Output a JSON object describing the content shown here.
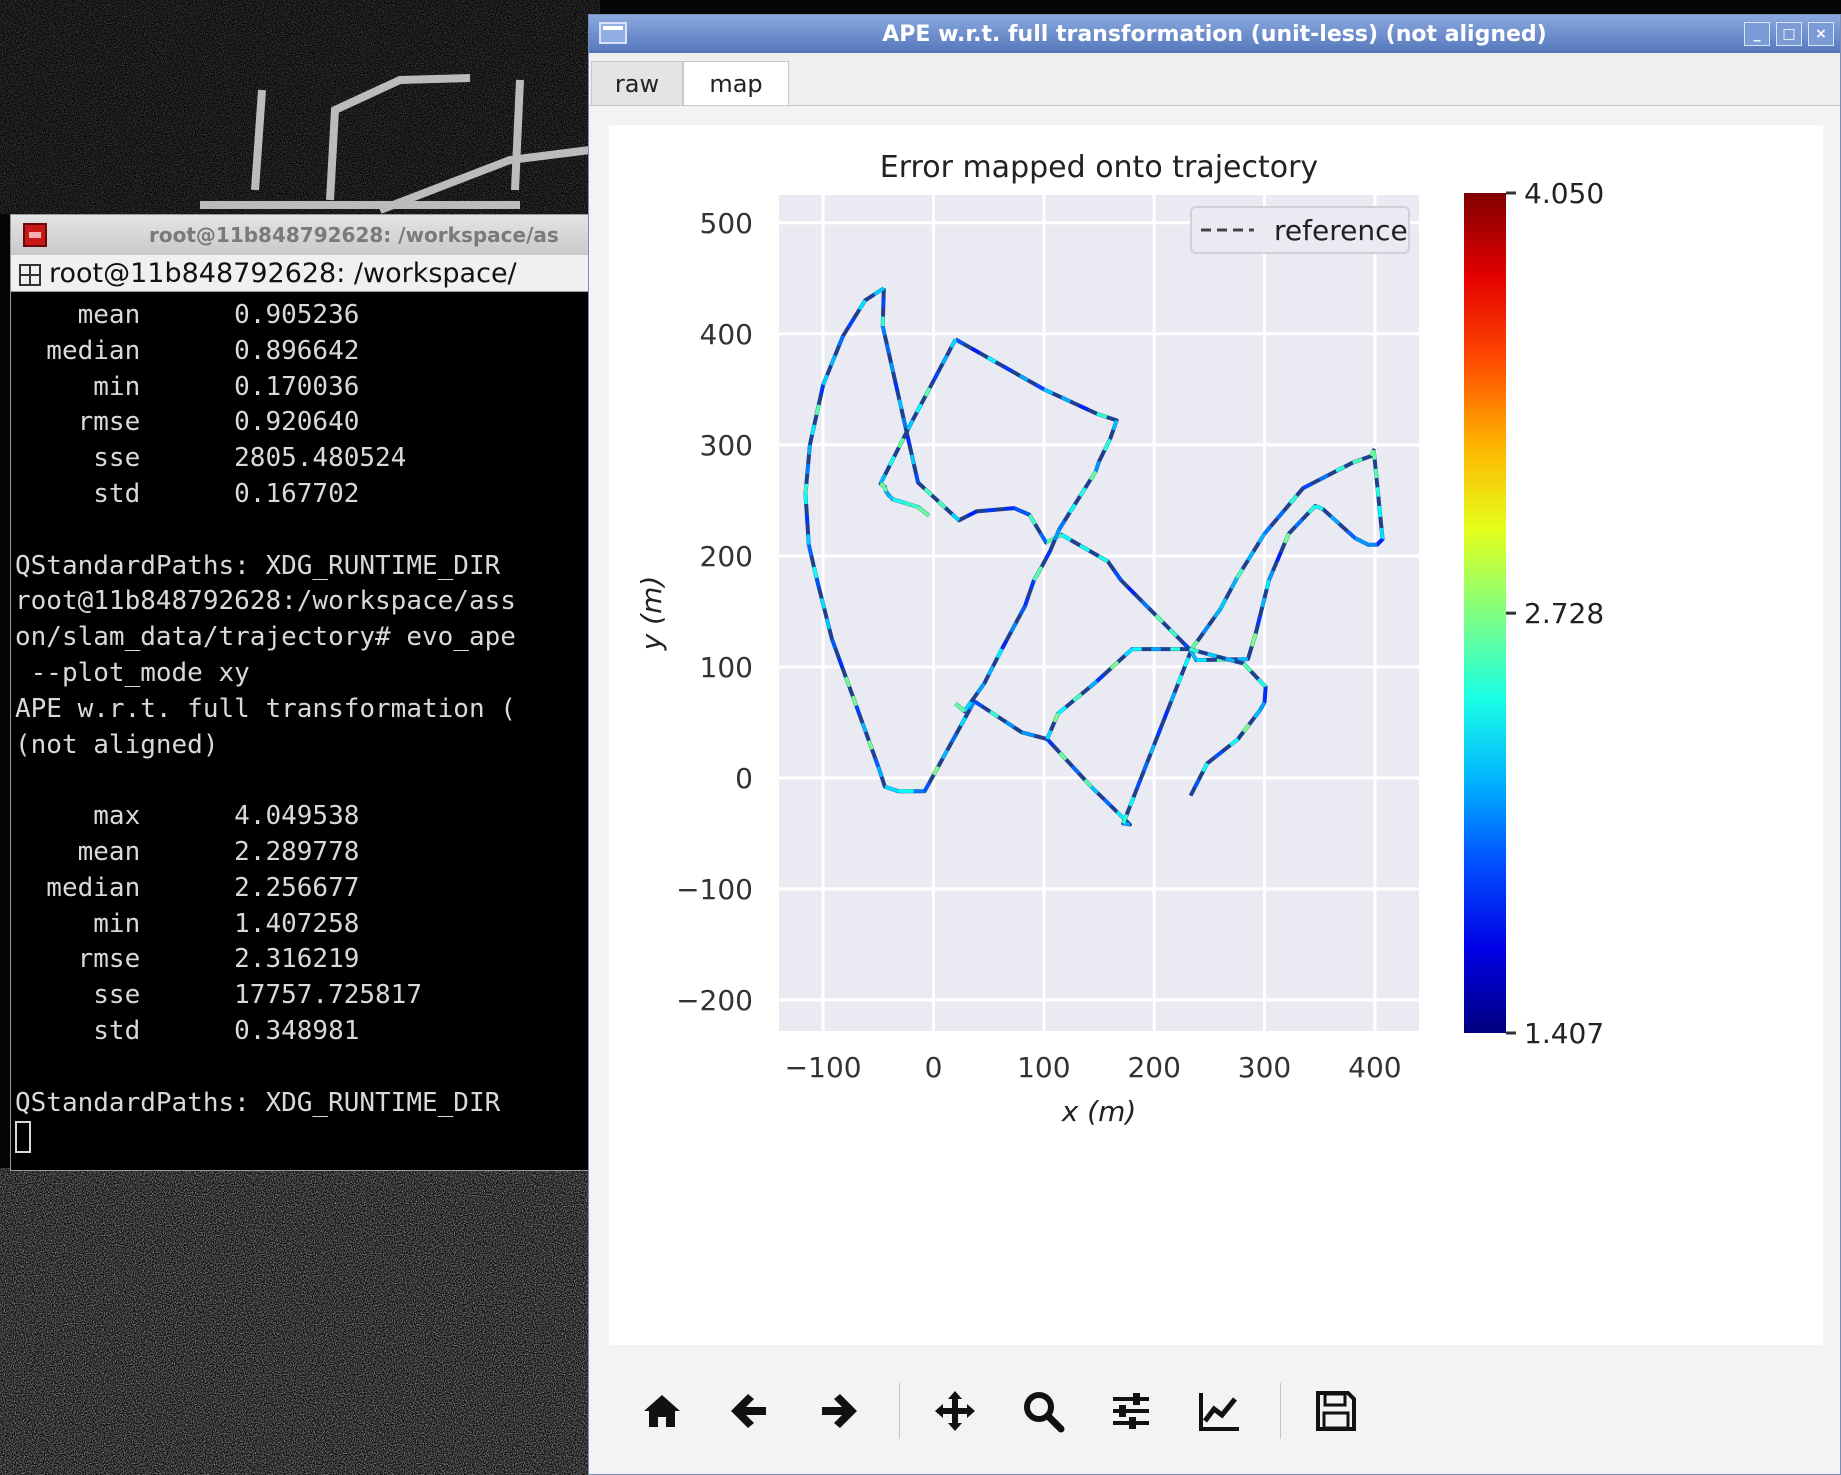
{
  "terminal": {
    "window_title": "root@11b848792628: /workspace/as",
    "tab_label": "root@11b848792628: /workspace/",
    "lines": [
      "    mean      0.905236",
      "  median      0.896642",
      "     min      0.170036",
      "    rmse      0.920640",
      "     sse      2805.480524",
      "     std      0.167702",
      "",
      "QStandardPaths: XDG_RUNTIME_DIR",
      "root@11b848792628:/workspace/ass",
      "on/slam_data/trajectory# evo_ape",
      " --plot_mode xy",
      "APE w.r.t. full transformation (",
      "(not aligned)",
      "",
      "     max      4.049538",
      "    mean      2.289778",
      "  median      2.256677",
      "     min      1.407258",
      "    rmse      2.316219",
      "     sse      17757.725817",
      "     std      0.348981",
      "",
      "QStandardPaths: XDG_RUNTIME_DIR"
    ]
  },
  "plot_window": {
    "title": "APE w.r.t. full transformation (unit-less) (not aligned)",
    "tabs": [
      "raw",
      "map"
    ],
    "active_tab": "map",
    "window_buttons": [
      "_",
      "□",
      "×"
    ],
    "toolbar_icons": [
      "home-icon",
      "back-arrow-icon",
      "forward-arrow-icon",
      "pan-move-icon",
      "zoom-magnifier-icon",
      "configure-subplots-icon",
      "edit-axis-icon",
      "save-icon"
    ]
  },
  "chart_data": {
    "type": "line",
    "title": "Error mapped onto trajectory",
    "xlabel": "x (m)",
    "ylabel": "y (m)",
    "xlim": [
      -140,
      440
    ],
    "ylim": [
      -228,
      525
    ],
    "xticks": [
      -100,
      0,
      100,
      200,
      300,
      400
    ],
    "xtick_labels": [
      "−100",
      "0",
      "100",
      "200",
      "300",
      "400"
    ],
    "yticks": [
      -200,
      -100,
      0,
      100,
      200,
      300,
      400,
      500
    ],
    "ytick_labels": [
      "−200",
      "−100",
      "0",
      "100",
      "200",
      "300",
      "400",
      "500"
    ],
    "grid": true,
    "background": "#eaeaf2",
    "legend": {
      "placement": "top-right",
      "entries": [
        "reference"
      ]
    },
    "colorbar": {
      "min": 1.407,
      "max": 4.05,
      "tick_values": [
        4.05,
        2.728,
        1.407
      ],
      "tick_labels": [
        "4.050",
        "2.728",
        "1.407"
      ],
      "colormap": "jet"
    },
    "series": [
      {
        "name": "reference",
        "style": "dashed",
        "color_by_error": true,
        "x": [
          -45,
          -62,
          -82,
          -100,
          -112,
          -116,
          -113,
          -106,
          -92,
          -70,
          -50,
          -44,
          -32,
          -18,
          -8,
          37,
          80,
          103,
          143,
          178,
          172,
          234,
          260,
          275,
          300,
          335,
          380,
          397,
          399,
          404,
          407,
          402,
          394,
          382,
          353,
          346,
          322,
          304,
          292,
          285,
          238,
          233,
          170,
          158,
          116,
          102,
          87,
          73,
          39,
          23,
          -14,
          -46,
          -45
        ],
        "y": [
          441,
          430,
          398,
          354,
          300,
          256,
          210,
          180,
          125,
          65,
          10,
          -8,
          -12,
          -12,
          -12,
          69,
          41,
          35,
          -8,
          -42,
          -41,
          116,
          152,
          180,
          220,
          261,
          284,
          290,
          295,
          245,
          215,
          210,
          210,
          216,
          242,
          245,
          220,
          178,
          130,
          107,
          106,
          115,
          178,
          195,
          219,
          212,
          237,
          243,
          240,
          232,
          266,
          407,
          441
        ]
      },
      {
        "name": "",
        "style": "dashed",
        "color_by_error": true,
        "x": [
          20,
          100,
          148,
          166,
          160,
          150,
          147,
          114,
          106,
          98,
          91,
          83,
          62,
          46,
          28,
          20
        ],
        "y": [
          395,
          350,
          328,
          322,
          305,
          285,
          276,
          224,
          205,
          190,
          178,
          155,
          116,
          85,
          60,
          67
        ]
      },
      {
        "name": "",
        "style": "dashed",
        "color_by_error": true,
        "x": [
          20,
          -19,
          -48,
          -44,
          -43,
          -40,
          -37,
          -27,
          -14,
          -4
        ],
        "y": [
          395,
          322,
          265,
          262,
          258,
          254,
          251,
          248,
          244,
          236
        ]
      },
      {
        "name": "",
        "style": "dashed",
        "color_by_error": true,
        "x": [
          103,
          113,
          148,
          180,
          232,
          281,
          301,
          300,
          296,
          276,
          248,
          233
        ],
        "y": [
          35,
          58,
          87,
          116,
          116,
          103,
          82,
          68,
          61,
          35,
          13,
          -16
        ]
      }
    ]
  }
}
